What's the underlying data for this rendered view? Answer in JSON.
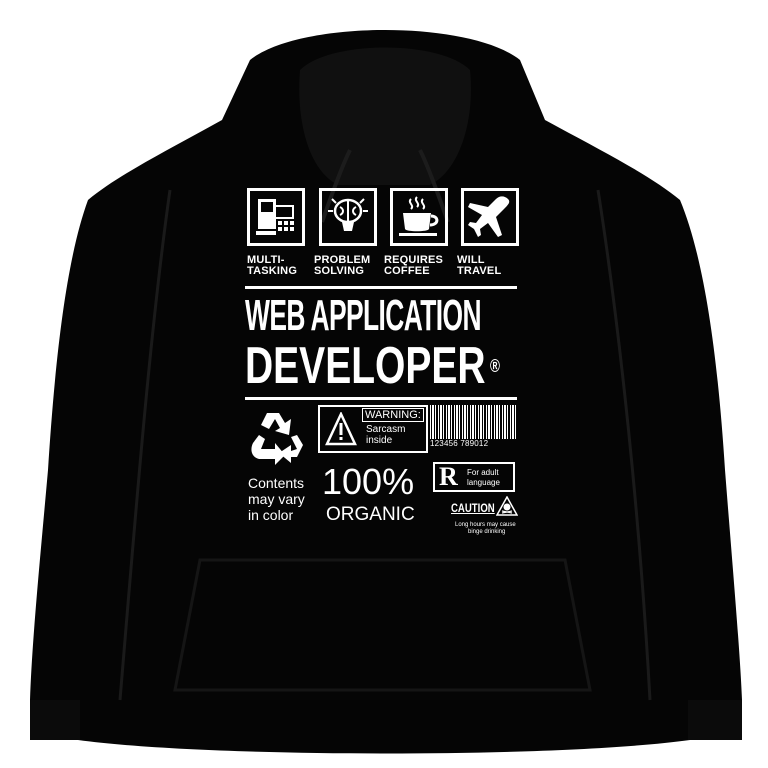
{
  "colors": {
    "background": "#ffffff",
    "garment": "#050505",
    "print": "#ffffff"
  },
  "icons": [
    {
      "name": "multitasking-icon",
      "line1": "MULTI-",
      "line2": "TASKING"
    },
    {
      "name": "brain-bulb-icon",
      "line1": "PROBLEM",
      "line2": "SOLVING"
    },
    {
      "name": "coffee-cup-icon",
      "line1": "REQUIRES",
      "line2": "COFFEE"
    },
    {
      "name": "airplane-icon",
      "line1": "WILL",
      "line2": "TRAVEL"
    }
  ],
  "title": {
    "line1": "WEB APPLICATION",
    "line2": "DEVELOPER",
    "mark": "®"
  },
  "warning": {
    "label": "WARNING:",
    "line1": "Sarcasm",
    "line2": "inside"
  },
  "barcode": {
    "digits": "123456 789012"
  },
  "contents": {
    "line1": "Contents",
    "line2": "may vary",
    "line3": "in color"
  },
  "organic": {
    "percent": "100%",
    "word": "ORGANIC"
  },
  "rating": {
    "letter": "R",
    "line1": "For adult",
    "line2": "language"
  },
  "caution": {
    "label": "CAUTION",
    "line1": "Long hours may cause",
    "line2": "binge drinking"
  }
}
